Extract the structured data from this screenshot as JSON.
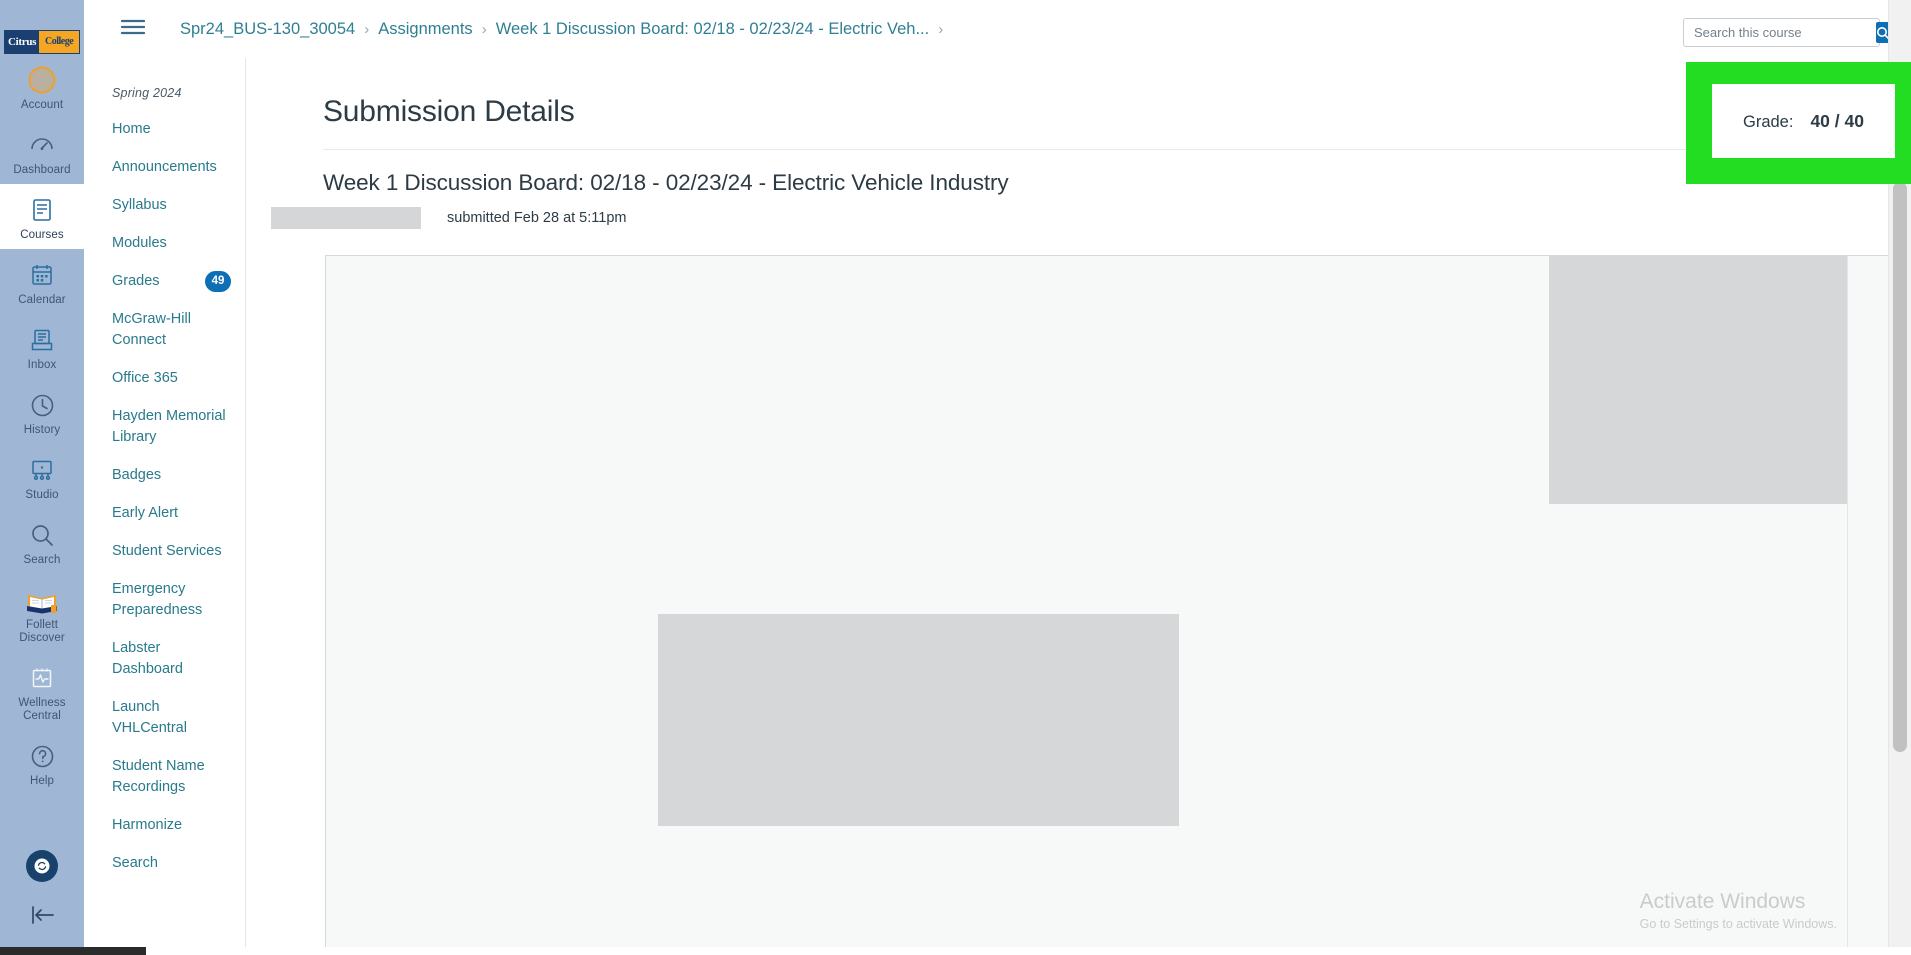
{
  "brand": {
    "name_part1": "Citrus",
    "name_part2": "College"
  },
  "global_nav": {
    "items": [
      {
        "label": "Account",
        "icon": "avatar-icon",
        "active": false
      },
      {
        "label": "Dashboard",
        "icon": "dashboard-icon",
        "active": false
      },
      {
        "label": "Courses",
        "icon": "courses-icon",
        "active": true
      },
      {
        "label": "Calendar",
        "icon": "calendar-icon",
        "active": false
      },
      {
        "label": "Inbox",
        "icon": "inbox-icon",
        "active": false
      },
      {
        "label": "History",
        "icon": "clock-icon",
        "active": false
      },
      {
        "label": "Studio",
        "icon": "studio-icon",
        "active": false
      },
      {
        "label": "Search",
        "icon": "magnifier-icon",
        "active": false
      },
      {
        "label": "Follett Discover",
        "icon": "open-book-icon",
        "active": false
      },
      {
        "label": "Wellness Central",
        "icon": "heartbeat-icon",
        "active": false
      },
      {
        "label": "Help",
        "icon": "question-mark-icon",
        "active": false
      }
    ],
    "chat_icon": "chat-bubble-icon",
    "collapse_icon": "collapse-arrow-icon"
  },
  "topbar": {
    "menu_icon": "hamburger-icon",
    "breadcrumb": [
      {
        "label": "Spr24_BUS-130_30054"
      },
      {
        "label": "Assignments"
      },
      {
        "label": "Week 1 Discussion Board: 02/18 - 02/23/24 - Electric Veh..."
      }
    ],
    "separator": "›"
  },
  "search": {
    "placeholder": "Search this course",
    "value": "",
    "button_icon": "search-icon"
  },
  "course_nav": {
    "term": "Spring 2024",
    "items": [
      {
        "label": "Home",
        "badge": null
      },
      {
        "label": "Announcements",
        "badge": null
      },
      {
        "label": "Syllabus",
        "badge": null
      },
      {
        "label": "Modules",
        "badge": null
      },
      {
        "label": "Grades",
        "badge": "49"
      },
      {
        "label": "McGraw-Hill Connect",
        "badge": null
      },
      {
        "label": "Office 365",
        "badge": null
      },
      {
        "label": "Hayden Memorial Library",
        "badge": null
      },
      {
        "label": "Badges",
        "badge": null
      },
      {
        "label": "Early Alert",
        "badge": null
      },
      {
        "label": "Student Services",
        "badge": null
      },
      {
        "label": "Emergency Preparedness",
        "badge": null
      },
      {
        "label": "Labster Dashboard",
        "badge": null
      },
      {
        "label": "Launch VHLCentral",
        "badge": null
      },
      {
        "label": "Student Name Recordings",
        "badge": null
      },
      {
        "label": "Harmonize",
        "badge": null
      },
      {
        "label": "Search",
        "badge": null
      }
    ]
  },
  "main": {
    "page_title": "Submission Details",
    "assignment_title": "Week 1 Discussion Board: 02/18 - 02/23/24 - Electric Vehicle Industry",
    "submitted_text": "submitted Feb 28 at 5:11pm",
    "student_name_redacted": ""
  },
  "grade_box": {
    "label": "Grade:",
    "value": "40 / 40",
    "highlight_color": "#22dd22"
  },
  "watermark": {
    "title": "Activate Windows",
    "subtitle": "Go to Settings to activate Windows."
  },
  "colors": {
    "global_nav_bg": "#9fb7d4",
    "link": "#297a8c",
    "badge": "#0f6fb5",
    "text": "#2d3b45"
  }
}
